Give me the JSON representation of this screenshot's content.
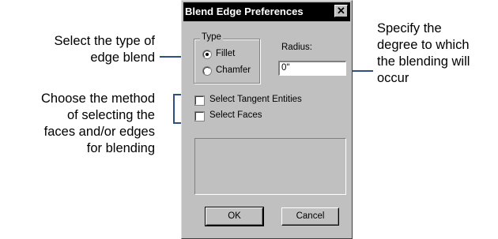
{
  "callouts": {
    "type_line1": "Select the type of",
    "type_line2": "edge blend",
    "method_line1": "Choose the method",
    "method_line2": "of selecting the",
    "method_line3": "faces and/or edges",
    "method_line4": "for blending",
    "radius_line1": "Specify the",
    "radius_line2": "degree to which",
    "radius_line3": "the blending will",
    "radius_line4": "occur"
  },
  "dialog": {
    "title": "Blend Edge Preferences",
    "close_glyph": "✕",
    "type_group_label": "Type",
    "radio_fillet": "Fillet",
    "radio_chamfer": "Chamfer",
    "selected_type": "Fillet",
    "radius_label": "Radius:",
    "radius_value": "0\"",
    "check_tangent": "Select Tangent Entities",
    "check_faces": "Select Faces",
    "tangent_checked": false,
    "faces_checked": false,
    "ok_label": "OK",
    "cancel_label": "Cancel"
  },
  "colors": {
    "callout_line": "#2b4f86",
    "dialog_face": "#c0c0c0",
    "titlebar": "#000000"
  }
}
